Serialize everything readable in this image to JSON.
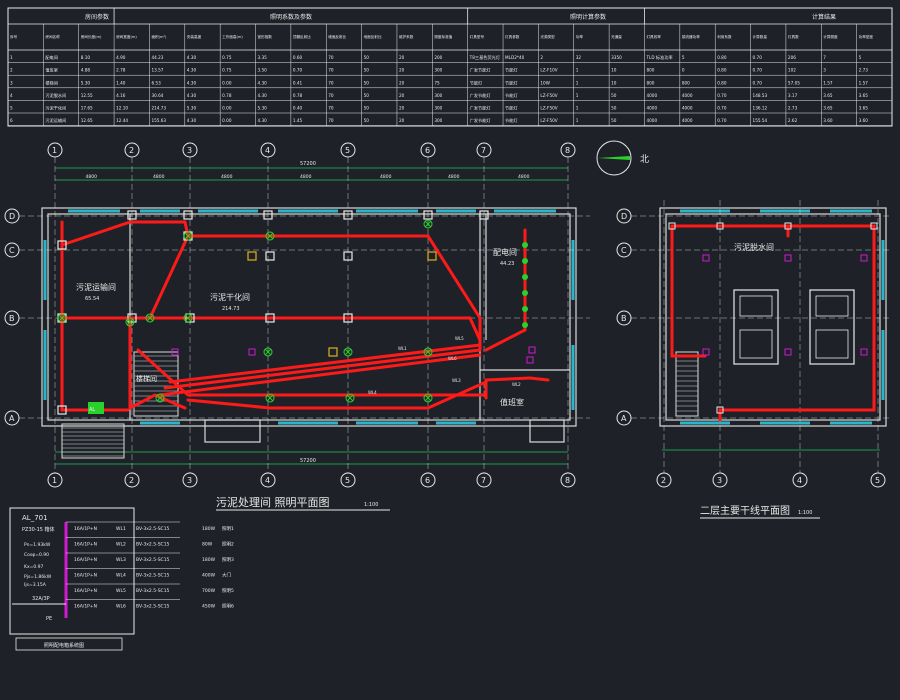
{
  "table": {
    "group_headers": [
      "房间参数",
      "照明系数及参数",
      "照明计算参数",
      "计算结果"
    ],
    "columns": [
      "序号",
      "房间名称",
      "房间长度(m)",
      "房间宽度(m)",
      "面积(m²)",
      "安装高度",
      "工作面高(m)",
      "室形指数",
      "顶棚反射比",
      "墙面反射比",
      "地面反射比",
      "维护系数",
      "照度标准值",
      "灯具型号",
      "灯具参数",
      "光源类型",
      "功率",
      "光通量",
      "灯具效率",
      "镇流器功率",
      "利用系数",
      "计算数量",
      "灯具数",
      "计算照度",
      "功率密度"
    ],
    "rows": [
      [
        "1",
        "配电间",
        "8.10",
        "4.90",
        "44.23",
        "4.30",
        "0.75",
        "3.35",
        "0.60",
        "70",
        "50",
        "20",
        "200",
        "T8三基色荧光灯",
        "MLD2*40",
        "2",
        "32",
        "3350",
        "TLD 标准功率",
        "5",
        "0.80",
        "0.70",
        "206",
        "7",
        "5"
      ],
      [
        "2",
        "值班室",
        "4.88",
        "2.78",
        "13.57",
        "4.30",
        "0.75",
        "3.50",
        "0.70",
        "70",
        "50",
        "20",
        "300",
        "广发节能灯",
        "节能灯",
        "LZ-F10V",
        "1",
        "10",
        "800",
        "0",
        "0.80",
        "0.70",
        "102",
        "3",
        "2.73"
      ],
      [
        "3",
        "楼梯间",
        "5.30",
        "1.40",
        "6.53",
        "4.30",
        "0.00",
        "4.30",
        "0.41",
        "70",
        "50",
        "20",
        "75",
        "节能灯",
        "节能灯",
        "10W",
        "1",
        "10",
        "800",
        "800",
        "0.80",
        "0.70",
        "57.05",
        "1.57",
        "1.57"
      ],
      [
        "4",
        "污泥脱水间",
        "12.55",
        "4.16",
        "30.64",
        "4.30",
        "0.78",
        "4.30",
        "0.78",
        "70",
        "50",
        "20",
        "300",
        "广发节能灯",
        "节能灯",
        "LZ-F50V",
        "1",
        "50",
        "4000",
        "4000",
        "0.70",
        "148.53",
        "3.17",
        "3.65",
        "3.65"
      ],
      [
        "5",
        "污泥干化间",
        "17.65",
        "12.10",
        "214.73",
        "5.30",
        "0.00",
        "5.30",
        "0.40",
        "70",
        "50",
        "20",
        "300",
        "广发节能灯",
        "节能灯",
        "LZ-F50V",
        "1",
        "50",
        "4000",
        "4000",
        "0.70",
        "136.12",
        "2.73",
        "3.65",
        "3.65"
      ],
      [
        "6",
        "污泥运输间",
        "12.65",
        "12.44",
        "155.63",
        "4.30",
        "0.00",
        "4.30",
        "1.45",
        "70",
        "50",
        "20",
        "300",
        "广发节能灯",
        "节能灯",
        "LZ-F50V",
        "1",
        "50",
        "4000",
        "4000",
        "0.70",
        "155.54",
        "2.62",
        "3.60",
        "3.60"
      ]
    ]
  },
  "plan1": {
    "axes_top": [
      "1",
      "2",
      "3",
      "4",
      "5",
      "6",
      "7",
      "8"
    ],
    "axes_side": [
      "D",
      "C",
      "B",
      "A"
    ],
    "dims_top": [
      "4800",
      "4800",
      "4800",
      "4800",
      "4800",
      "4800",
      "4800"
    ],
    "dim_total": "57200",
    "rooms": [
      {
        "name": "污泥运输间",
        "area": "65.54"
      },
      {
        "name": "污泥干化间",
        "area": "214.73"
      },
      {
        "name": "配电间",
        "area": "44.23"
      },
      {
        "name": "值班室",
        "area": ""
      },
      {
        "name": "楼梯间",
        "area": ""
      }
    ],
    "circuit_labels": [
      "WL1",
      "WL2",
      "WL3",
      "WL4",
      "WL5",
      "WL6"
    ],
    "panel_tag": "AL",
    "title": "污泥处理间 照明平面图",
    "scale": "1:100"
  },
  "plan2": {
    "axes_bottom": [
      "2",
      "3",
      "4",
      "5"
    ],
    "axes_side": [
      "D",
      "C",
      "B",
      "A"
    ],
    "room": "污泥脱水间",
    "title": "二层主要干线平面图",
    "scale": "1:100"
  },
  "north": "北",
  "panel": {
    "name": "AL_701",
    "model": "PZ30-15 箱体",
    "params": [
      "Pn=1.93kW",
      "Kx=0.97",
      "Pjs=1.86kW",
      "Ijs=3.15A",
      "Cosφ=0.90"
    ],
    "incoming": "32A/3P",
    "pe": "PE",
    "circuits": [
      {
        "breaker": "16A/1P+N",
        "id": "WL1",
        "cable": "BV-3x2.5-SC15",
        "load": "180W",
        "room": "照明1"
      },
      {
        "breaker": "16A/1P+N",
        "id": "WL2",
        "cable": "BV-3x2.5-SC15",
        "load": "80W",
        "room": "照明2"
      },
      {
        "breaker": "16A/1P+N",
        "id": "WL3",
        "cable": "BV-3x2.5-SC15",
        "load": "180W",
        "room": "照明3"
      },
      {
        "breaker": "16A/1P+N",
        "id": "WL4",
        "cable": "BV-3x2.5-SC15",
        "load": "400W",
        "room": "大门"
      },
      {
        "breaker": "16A/1P+N",
        "id": "WL5",
        "cable": "BV-3x2.5-SC15",
        "load": "700W",
        "room": "照明5"
      },
      {
        "breaker": "16A/1P+N",
        "id": "WL6",
        "cable": "BV-3x2.5-SC15",
        "load": "450W",
        "room": "照明6"
      }
    ],
    "caption": "照明配电箱系统图"
  },
  "colors": {
    "bg": "#1e2228",
    "wire": "#ff1a1a",
    "dim": "#21c45a",
    "window": "#2ab6c8",
    "panel": "#d01ad0",
    "lamp": "#e0b020"
  }
}
